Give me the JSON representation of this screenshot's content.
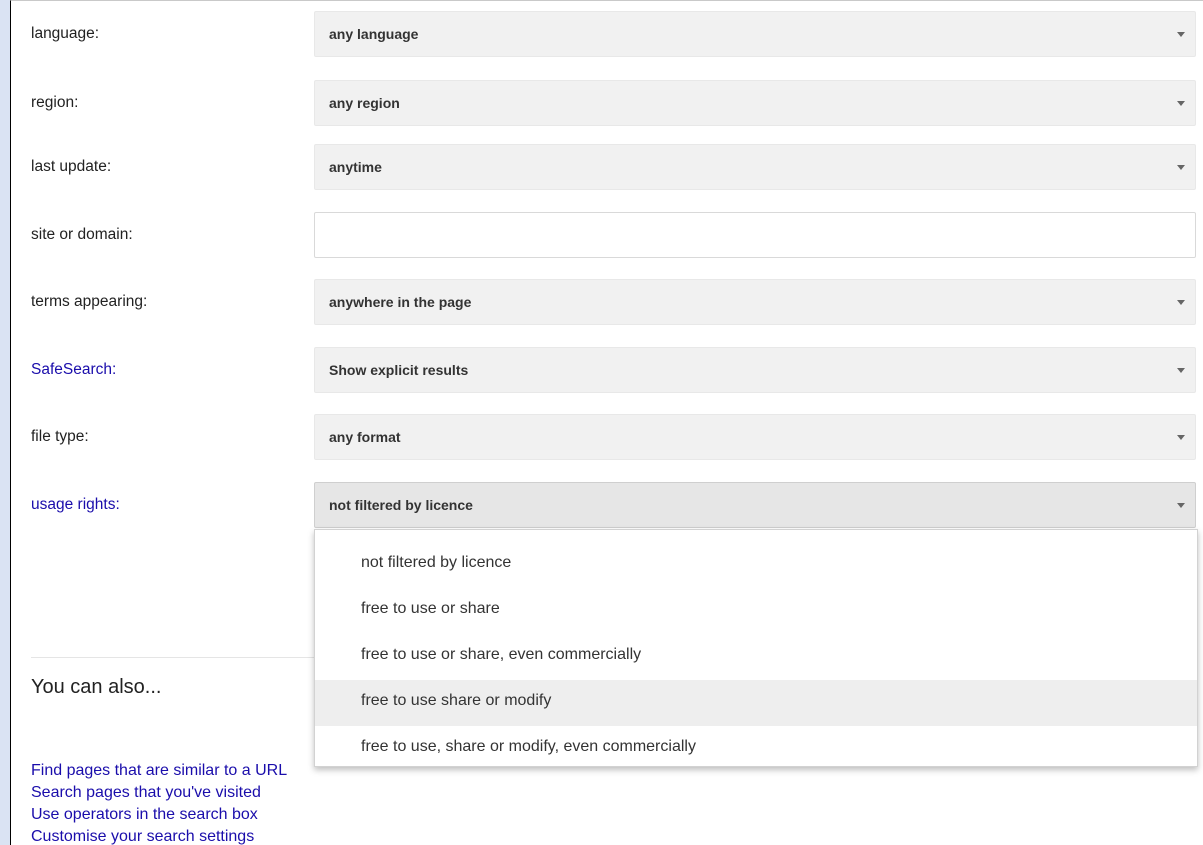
{
  "form": {
    "rows": [
      {
        "label": "language:",
        "type": "select",
        "value": "any language",
        "link": false
      },
      {
        "label": "region:",
        "type": "select",
        "value": "any region",
        "link": false
      },
      {
        "label": "last update:",
        "type": "select",
        "value": "anytime",
        "link": false
      },
      {
        "label": "site or domain:",
        "type": "input",
        "value": "",
        "link": false
      },
      {
        "label": "terms appearing:",
        "type": "select",
        "value": "anywhere in the page",
        "link": false
      },
      {
        "label": "SafeSearch:",
        "type": "select",
        "value": "Show explicit results",
        "link": true
      },
      {
        "label": "file type:",
        "type": "select",
        "value": "any format",
        "link": false
      },
      {
        "label": "usage rights:",
        "type": "select",
        "value": "not filtered by licence",
        "link": true
      }
    ]
  },
  "usage_rights_dropdown": {
    "options": [
      "not filtered by licence",
      "free to use or share",
      "free to use or share, even commercially",
      "free to use share or modify",
      "free to use, share or modify, even commercially"
    ],
    "highlighted_option": "free to use share or modify"
  },
  "also": {
    "title": "You can also...",
    "links": [
      "Find pages that are similar to a URL",
      "Search pages that you've visited",
      "Use operators in the search box",
      "Customise your search settings"
    ]
  },
  "colors": {
    "link": "#1a0dab",
    "background": "#dae3f3",
    "select_bg": "#f1f1f1"
  },
  "icons": {
    "select_arrow": "chevron-down-icon"
  }
}
